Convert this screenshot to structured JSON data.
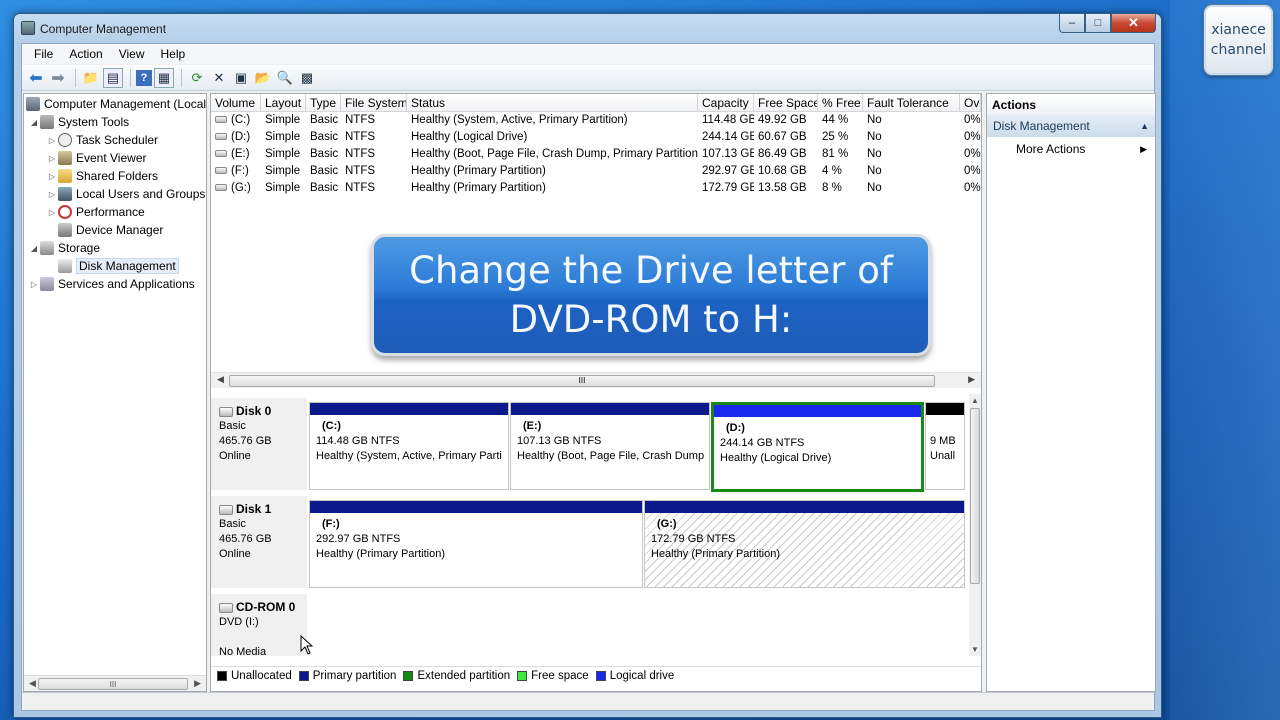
{
  "badge": {
    "line1": "xianece",
    "line2": "channel"
  },
  "window": {
    "title": "Computer Management",
    "min": "‒",
    "max": "□",
    "close": "✕"
  },
  "menu": [
    "File",
    "Action",
    "View",
    "Help"
  ],
  "tree": {
    "root": "Computer Management (Local",
    "system_tools": "System Tools",
    "task_scheduler": "Task Scheduler",
    "event_viewer": "Event Viewer",
    "shared_folders": "Shared Folders",
    "local_users": "Local Users and Groups",
    "performance": "Performance",
    "device_manager": "Device Manager",
    "storage": "Storage",
    "disk_management": "Disk Management",
    "services": "Services and Applications"
  },
  "volume_table": {
    "headers": [
      "Volume",
      "Layout",
      "Type",
      "File System",
      "Status",
      "Capacity",
      "Free Space",
      "% Free",
      "Fault Tolerance",
      "Ove"
    ],
    "rows": [
      [
        "(C:)",
        "Simple",
        "Basic",
        "NTFS",
        "Healthy (System, Active, Primary Partition)",
        "114.48 GB",
        "49.92 GB",
        "44 %",
        "No",
        "0%"
      ],
      [
        "(D:)",
        "Simple",
        "Basic",
        "NTFS",
        "Healthy (Logical Drive)",
        "244.14 GB",
        "60.67 GB",
        "25 %",
        "No",
        "0%"
      ],
      [
        "(E:)",
        "Simple",
        "Basic",
        "NTFS",
        "Healthy (Boot, Page File, Crash Dump, Primary Partition)",
        "107.13 GB",
        "86.49 GB",
        "81 %",
        "No",
        "0%"
      ],
      [
        "(F:)",
        "Simple",
        "Basic",
        "NTFS",
        "Healthy (Primary Partition)",
        "292.97 GB",
        "10.68 GB",
        "4 %",
        "No",
        "0%"
      ],
      [
        "(G:)",
        "Simple",
        "Basic",
        "NTFS",
        "Healthy (Primary Partition)",
        "172.79 GB",
        "13.58 GB",
        "8 %",
        "No",
        "0%"
      ]
    ]
  },
  "banner": {
    "line1": "Change the Drive letter of",
    "line2": "DVD-ROM to H:"
  },
  "scroll_grip": "III",
  "disks": {
    "disk0": {
      "name": "Disk 0",
      "type": "Basic",
      "size": "465.76 GB",
      "status": "Online"
    },
    "disk1": {
      "name": "Disk 1",
      "type": "Basic",
      "size": "465.76 GB",
      "status": "Online"
    },
    "cdrom0": {
      "name": "CD-ROM 0",
      "type": "DVD (I:)",
      "status": "No Media"
    }
  },
  "partitions": {
    "c": {
      "name": "(C:)",
      "size": "114.48 GB NTFS",
      "status": "Healthy (System, Active, Primary Parti"
    },
    "e": {
      "name": "(E:)",
      "size": "107.13 GB NTFS",
      "status": "Healthy (Boot, Page File, Crash Dump"
    },
    "d": {
      "name": "(D:)",
      "size": "244.14 GB NTFS",
      "status": "Healthy (Logical Drive)"
    },
    "unalloc": {
      "size": "9 MB",
      "status": "Unall"
    },
    "f": {
      "name": "(F:)",
      "size": "292.97 GB NTFS",
      "status": "Healthy (Primary Partition)"
    },
    "g": {
      "name": "(G:)",
      "size": "172.79 GB NTFS",
      "status": "Healthy (Primary Partition)"
    }
  },
  "legend": [
    {
      "label": "Unallocated",
      "color": "#000000"
    },
    {
      "label": "Primary partition",
      "color": "#0c1a8c"
    },
    {
      "label": "Extended partition",
      "color": "#168a16"
    },
    {
      "label": "Free space",
      "color": "#3ee83e"
    },
    {
      "label": "Logical drive",
      "color": "#1a29ee"
    }
  ],
  "actions": {
    "title": "Actions",
    "section": "Disk Management",
    "more": "More Actions"
  }
}
